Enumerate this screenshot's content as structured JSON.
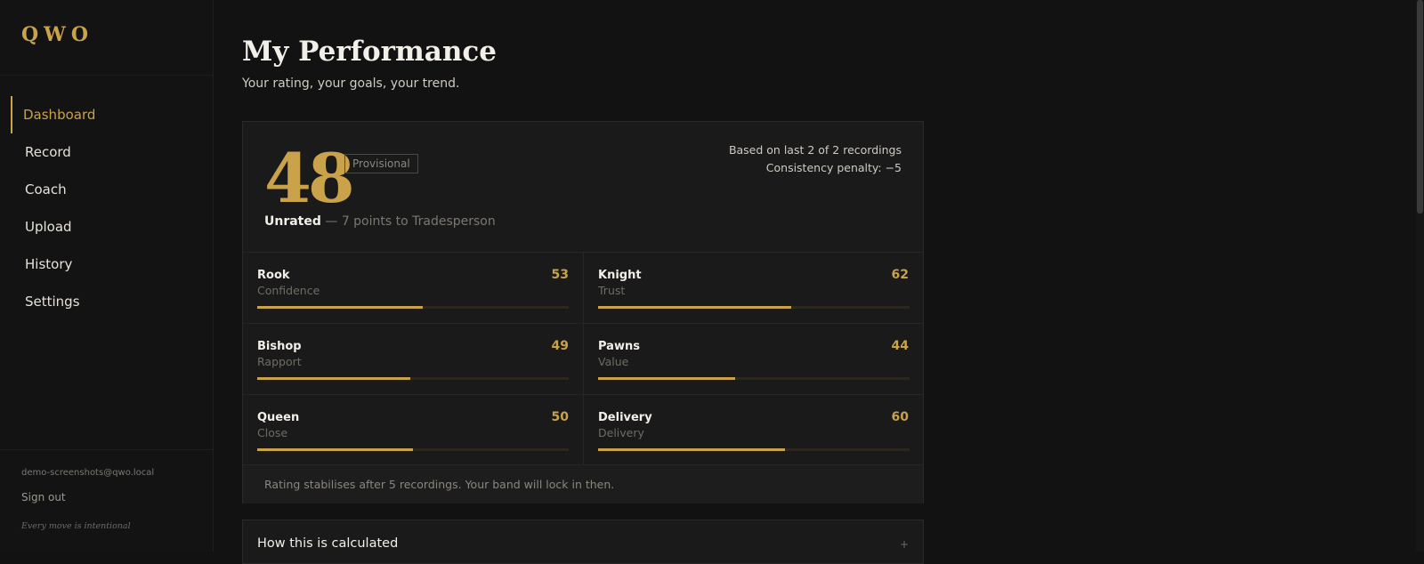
{
  "brand": {
    "logo": "QWO",
    "tagline": "Every move is intentional"
  },
  "sidebar": {
    "items": [
      {
        "label": "Dashboard",
        "active": true
      },
      {
        "label": "Record",
        "active": false
      },
      {
        "label": "Coach",
        "active": false
      },
      {
        "label": "Upload",
        "active": false
      },
      {
        "label": "History",
        "active": false
      },
      {
        "label": "Settings",
        "active": false
      }
    ],
    "email": "demo-screenshots@qwo.local",
    "signout": "Sign out"
  },
  "page": {
    "title": "My Performance",
    "subtitle": "Your rating, your goals, your trend."
  },
  "rating": {
    "score": "48",
    "badge": "Provisional",
    "band": "Unrated",
    "separator": "—",
    "next": "7 points to Tradesperson",
    "based_on": "Based on last 2 of 2 recordings",
    "penalty": "Consistency penalty: −5"
  },
  "pieces": [
    {
      "name": "Rook",
      "skill": "Confidence",
      "value": "53",
      "fill": 0.53
    },
    {
      "name": "Knight",
      "skill": "Trust",
      "value": "62",
      "fill": 0.62
    },
    {
      "name": "Bishop",
      "skill": "Rapport",
      "value": "49",
      "fill": 0.49
    },
    {
      "name": "Pawns",
      "skill": "Value",
      "value": "44",
      "fill": 0.44
    },
    {
      "name": "Queen",
      "skill": "Close",
      "value": "50",
      "fill": 0.5
    },
    {
      "name": "Delivery",
      "skill": "Delivery",
      "value": "60",
      "fill": 0.6
    }
  ],
  "card_footer": "Rating stabilises after 5 recordings. Your band will lock in then.",
  "accordion": {
    "title": "How this is calculated",
    "icon": "+"
  },
  "colors": {
    "accent": "#c9a24a",
    "background": "#121212",
    "card": "#1a1a1a"
  }
}
